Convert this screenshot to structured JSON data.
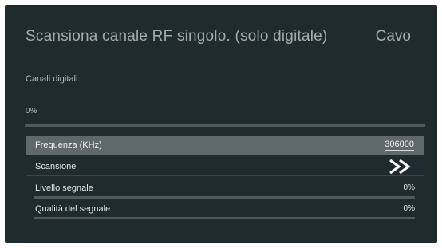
{
  "header": {
    "title": "Scansiona canale RF singolo. (solo digitale)",
    "mode": "Cavo"
  },
  "channels": {
    "label": "Canali digitali:"
  },
  "scan_progress": {
    "text": "0%",
    "value": 0
  },
  "settings": {
    "frequency": {
      "label": "Frequenza (KHz)",
      "value": "306000"
    },
    "scan": {
      "label": "Scansione",
      "icon": "double-chevron-right-icon"
    },
    "signal_level": {
      "label": "Livello segnale",
      "value_text": "0%",
      "value": 0
    },
    "signal_quality": {
      "label": "Qualità del segnale",
      "value_text": "0%",
      "value": 0
    }
  },
  "colors": {
    "background": "#1f2b2f",
    "highlight": "#5f696d",
    "track": "#4f5a5e"
  }
}
